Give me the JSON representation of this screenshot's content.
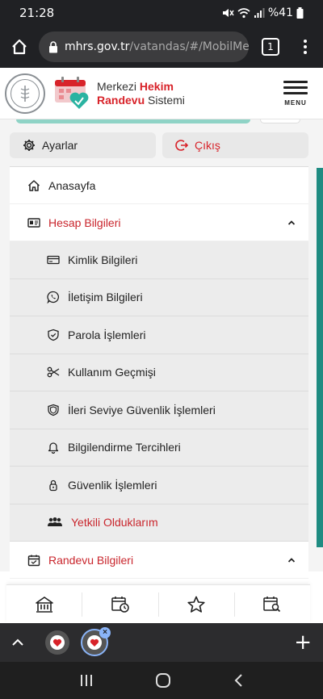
{
  "status_bar": {
    "time": "21:28",
    "battery_text": "%41",
    "icons": [
      "mute-icon",
      "wifi-icon",
      "signal-icon",
      "battery-icon"
    ]
  },
  "browser": {
    "url_domain": "mhrs.gov.tr",
    "url_path": "/vatandas/#/MobilMenu",
    "tab_count": "1"
  },
  "header": {
    "logo_line1_a": "Merkezi",
    "logo_line1_b": "Hekim",
    "logo_line2_a": "Randevu",
    "logo_line2_b": "Sistemi",
    "menu_label": "MENU"
  },
  "actions": {
    "settings_label": "Ayarlar",
    "logout_label": "Çıkış"
  },
  "menu": {
    "home": "Anasayfa",
    "account_info": "Hesap Bilgileri",
    "account_sub": [
      {
        "label": "Kimlik Bilgileri",
        "icon": "card-icon"
      },
      {
        "label": "İletişim Bilgileri",
        "icon": "whatsapp-icon"
      },
      {
        "label": "Parola İşlemleri",
        "icon": "shield-check-icon"
      },
      {
        "label": "Kullanım Geçmişi",
        "icon": "scissors-icon"
      },
      {
        "label": "İleri Seviye Güvenlik İşlemleri",
        "icon": "shield-icon"
      },
      {
        "label": "Bilgilendirme Tercihleri",
        "icon": "bell-icon"
      },
      {
        "label": "Güvenlik İşlemleri",
        "icon": "lock-icon"
      },
      {
        "label": "Yetkili Olduklarım",
        "icon": "users-icon"
      }
    ],
    "appointment_info": "Randevu Bilgileri"
  },
  "colors": {
    "brand_red": "#d8232a",
    "brand_teal": "#1f8c82",
    "sub_bg": "#ececec"
  }
}
